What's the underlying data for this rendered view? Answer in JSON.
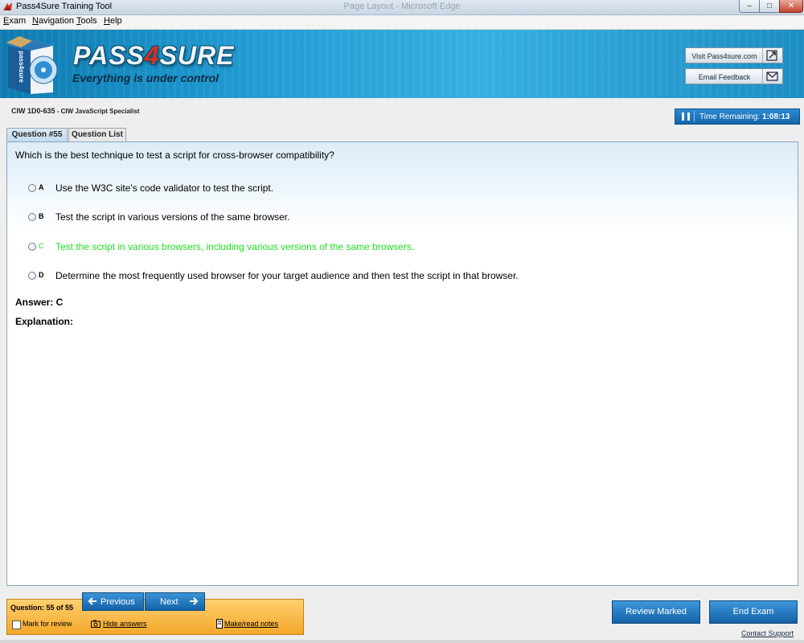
{
  "window": {
    "app_title": "Pass4Sure Training Tool",
    "faded_title": "Page Layout - Microsoft Edge",
    "minimize_glyph": "–",
    "maximize_glyph": "□",
    "close_glyph": "✕"
  },
  "menu": [
    "Exam",
    "Navigation",
    "Tools",
    "Help"
  ],
  "banner": {
    "brand_prefix": "PASS",
    "brand_number": "4",
    "brand_suffix": "SURE",
    "tagline": "Everything is under control",
    "box_text": "pass4sure",
    "visit_button": "Visit Pass4sure.com",
    "feedback_button": "Email Feedback"
  },
  "exam": {
    "code": "CIW 1D0-635",
    "separator": " - ",
    "name": "CIW JavaScript Specialist"
  },
  "timer": {
    "label": "Time Remaining:",
    "value": "1:08:13"
  },
  "tabs": {
    "question": "Question #55",
    "question_list": "Question List"
  },
  "question": {
    "text": "Which is the best technique to test a script for cross-browser compatibility?",
    "options": [
      {
        "letter": "A",
        "text": "Use the W3C site's code validator to test the script."
      },
      {
        "letter": "B",
        "text": "Test the script in various versions of the same browser."
      },
      {
        "letter": "C",
        "text": "Test the script in various browsers, including various versions of the same browsers."
      },
      {
        "letter": "D",
        "text": "Determine the most frequently used browser for your target audience and then test the script in that browser."
      }
    ],
    "answer": "Answer: C",
    "explanation": "Explanation:"
  },
  "footer": {
    "counter": "Question: 55 of 55",
    "previous": "Previous",
    "next": "Next",
    "mark_for_review": "Mark for review",
    "hide_answers": "Hide answers",
    "notes": "Make/read notes",
    "review_marked": "Review Marked",
    "end_exam": "End Exam",
    "contact_support": "Contact Support"
  },
  "colors": {
    "banner_blue": "#1f9bd2",
    "correct_green": "#22e022",
    "button_blue": "#1463a8",
    "footer_orange": "#f3a72b",
    "brand_red": "#d23422"
  }
}
